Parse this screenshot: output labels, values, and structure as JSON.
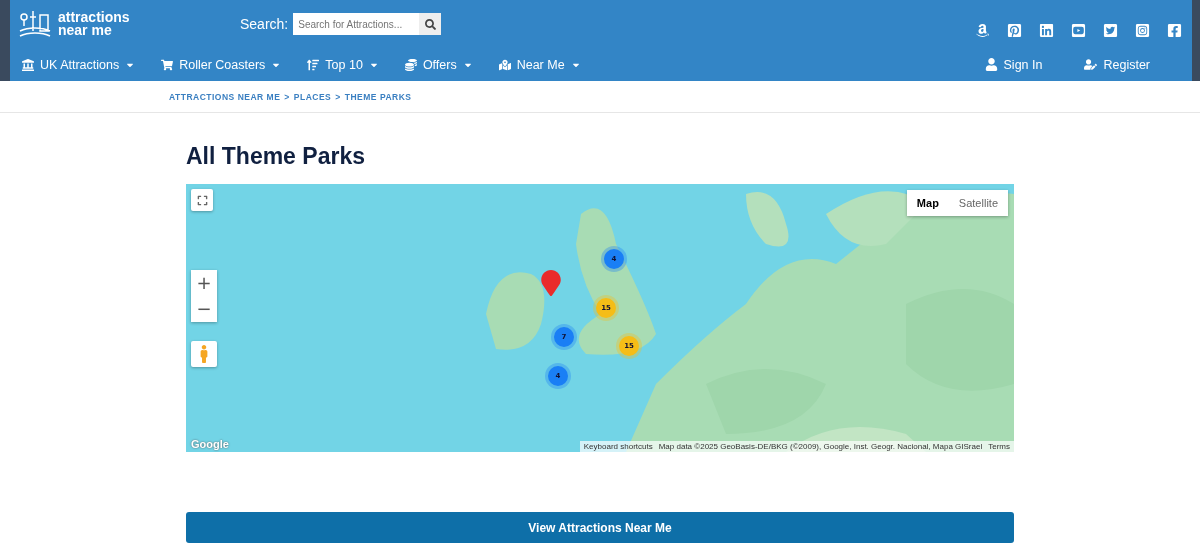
{
  "header": {
    "logo": [
      "attractions",
      "near me"
    ],
    "search": {
      "label": "Search:",
      "placeholder": "Search for Attractions..."
    },
    "social": [
      {
        "kind": "amazon"
      },
      {
        "kind": "pinterest"
      },
      {
        "kind": "linkedin"
      },
      {
        "kind": "youtube"
      },
      {
        "kind": "twitter"
      },
      {
        "kind": "instagram"
      },
      {
        "kind": "facebook"
      }
    ],
    "nav": [
      {
        "label": "UK Attractions",
        "kind": "landmark"
      },
      {
        "label": "Roller Coasters",
        "kind": "cart"
      },
      {
        "label": "Top 10",
        "kind": "sort"
      },
      {
        "label": "Offers",
        "kind": "coins"
      },
      {
        "label": "Near Me",
        "kind": "map"
      }
    ],
    "account": [
      {
        "label": "Sign In",
        "kind": "user"
      },
      {
        "label": "Register",
        "kind": "user-edit"
      }
    ]
  },
  "breadcrumb": [
    "ATTRACTIONS NEAR ME",
    "PLACES",
    "THEME PARKS"
  ],
  "breadcrumb_separator": ">",
  "title": "All Theme Parks",
  "map": {
    "kind": "picture",
    "map_types": [
      {
        "label": "Map",
        "selected": true
      },
      {
        "label": "Satellite",
        "selected": false
      }
    ],
    "zoom_in": "+",
    "zoom_out": "−",
    "markers": [
      {
        "kind": "pin",
        "color": "#ea2b2b"
      },
      {
        "kind": "cluster",
        "count": "4",
        "color": "#1a7ff5"
      },
      {
        "kind": "cluster",
        "count": "15",
        "color": "#f5bd17"
      },
      {
        "kind": "cluster",
        "count": "7",
        "color": "#1a7ff5"
      },
      {
        "kind": "cluster",
        "count": "15",
        "color": "#f5bd17"
      },
      {
        "kind": "cluster",
        "count": "4",
        "color": "#1a7ff5"
      }
    ],
    "logo": "Google",
    "attribution": [
      "Keyboard shortcuts",
      "Map data ©2025 GeoBasis-DE/BKG (©2009), Google, Inst. Geogr. Nacional, Mapa GISrael",
      "Terms"
    ]
  },
  "cta": "View Attractions Near Me"
}
